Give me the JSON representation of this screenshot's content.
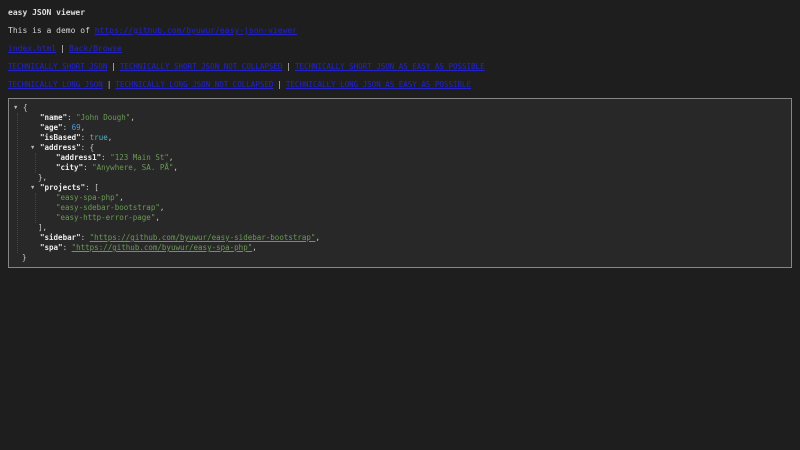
{
  "title": "easy JSON viewer",
  "intro": {
    "text": "This is a demo of ",
    "link_label": "https://github.com/byuwur/easy-json-viewer"
  },
  "separator": "|",
  "nav_files": {
    "links": [
      "index.html",
      "Back/Browse"
    ]
  },
  "nav_short": {
    "links": [
      "TECHNICALLY SHORT JSON",
      "TECHNICALLY SHORT JSON NOT COLLAPSED",
      "TECHNICALLY SHORT JSON AS EASY AS POSSIBLE"
    ]
  },
  "nav_long": {
    "links": [
      "TECHNICALLY LONG JSON",
      "TECHNICALLY LONG JSON NOT COLLAPSED",
      "TECHNICALLY LONG JSON AS EASY AS POSSIBLE"
    ]
  },
  "colors": {
    "page_background": "#1e1e1e",
    "panel_background": "#282828",
    "panel_border": "#868686",
    "top_link_blue": "#2323ce",
    "key_white": "#ececec",
    "string_green": "#6a9955",
    "number_blue": "#569cd6",
    "boolean_teal": "#4fb3c6",
    "json_link_green": "#6a9955"
  },
  "viewer": {
    "caret_glyph": "▼",
    "json_object": {
      "name": "John Dough",
      "age": 69,
      "isBased": true,
      "address": {
        "address1": "123 Main St",
        "city": "Anywhere, SA. PÅ"
      },
      "projects": [
        "easy-spa-php",
        "easy-sdebar-bootstrap",
        "easy-http-error-page"
      ],
      "sidebar": "https://github.com/byuwur/easy-sidebar-bootstrap",
      "spa": "https://github.com/byuwur/easy-spa-php"
    },
    "lines": [
      {
        "ind": 5,
        "tokens": [
          {
            "c": "caret",
            "t": ""
          },
          {
            "c": "punct",
            "t": "{"
          }
        ]
      },
      {
        "ind": 31,
        "tokens": [
          {
            "c": "key",
            "t": "\"name\""
          },
          {
            "c": "punct",
            "t": ": "
          },
          {
            "c": "str",
            "t": "\"John Dough\""
          },
          {
            "c": "punct",
            "t": ","
          }
        ]
      },
      {
        "ind": 31,
        "tokens": [
          {
            "c": "key",
            "t": "\"age\""
          },
          {
            "c": "punct",
            "t": ": "
          },
          {
            "c": "num",
            "t": "69"
          },
          {
            "c": "punct",
            "t": ","
          }
        ]
      },
      {
        "ind": 31,
        "tokens": [
          {
            "c": "key",
            "t": "\"isBased\""
          },
          {
            "c": "punct",
            "t": ": "
          },
          {
            "c": "bool",
            "t": "true"
          },
          {
            "c": "punct",
            "t": ","
          }
        ]
      },
      {
        "ind": 22,
        "tokens": [
          {
            "c": "caret",
            "t": ""
          },
          {
            "c": "key",
            "t": "\"address\""
          },
          {
            "c": "punct",
            "t": ": "
          },
          {
            "c": "punct",
            "t": "{"
          }
        ]
      },
      {
        "ind": 47,
        "tokens": [
          {
            "c": "key",
            "t": "\"address1\""
          },
          {
            "c": "punct",
            "t": ": "
          },
          {
            "c": "str",
            "t": "\"123 Main St\""
          },
          {
            "c": "punct",
            "t": ","
          }
        ]
      },
      {
        "ind": 47,
        "tokens": [
          {
            "c": "key",
            "t": "\"city\""
          },
          {
            "c": "punct",
            "t": ": "
          },
          {
            "c": "str",
            "t": "\"Anywhere, SA. PÅ\""
          },
          {
            "c": "punct",
            "t": ","
          }
        ]
      },
      {
        "ind": 29,
        "tokens": [
          {
            "c": "punct",
            "t": "},"
          }
        ]
      },
      {
        "ind": 22,
        "tokens": [
          {
            "c": "caret",
            "t": ""
          },
          {
            "c": "key",
            "t": "\"projects\""
          },
          {
            "c": "punct",
            "t": ": "
          },
          {
            "c": "punct",
            "t": "["
          }
        ]
      },
      {
        "ind": 47,
        "tokens": [
          {
            "c": "str",
            "t": "\"easy-spa-php\""
          },
          {
            "c": "punct",
            "t": ","
          }
        ]
      },
      {
        "ind": 47,
        "tokens": [
          {
            "c": "str",
            "t": "\"easy-sdebar-bootstrap\""
          },
          {
            "c": "punct",
            "t": ","
          }
        ]
      },
      {
        "ind": 47,
        "tokens": [
          {
            "c": "str",
            "t": "\"easy-http-error-page\""
          },
          {
            "c": "punct",
            "t": ","
          }
        ]
      },
      {
        "ind": 29,
        "tokens": [
          {
            "c": "punct",
            "t": "],"
          }
        ]
      },
      {
        "ind": 31,
        "tokens": [
          {
            "c": "key",
            "t": "\"sidebar\""
          },
          {
            "c": "punct",
            "t": ": "
          },
          {
            "c": "link",
            "t": "\"https://github.com/byuwur/easy-sidebar-bootstrap\""
          },
          {
            "c": "punct",
            "t": ","
          }
        ]
      },
      {
        "ind": 31,
        "tokens": [
          {
            "c": "key",
            "t": "\"spa\""
          },
          {
            "c": "punct",
            "t": ": "
          },
          {
            "c": "link",
            "t": "\"https://github.com/byuwur/easy-spa-php\""
          },
          {
            "c": "punct",
            "t": ","
          }
        ]
      },
      {
        "ind": 13,
        "tokens": [
          {
            "c": "punct",
            "t": "}"
          }
        ]
      }
    ]
  }
}
